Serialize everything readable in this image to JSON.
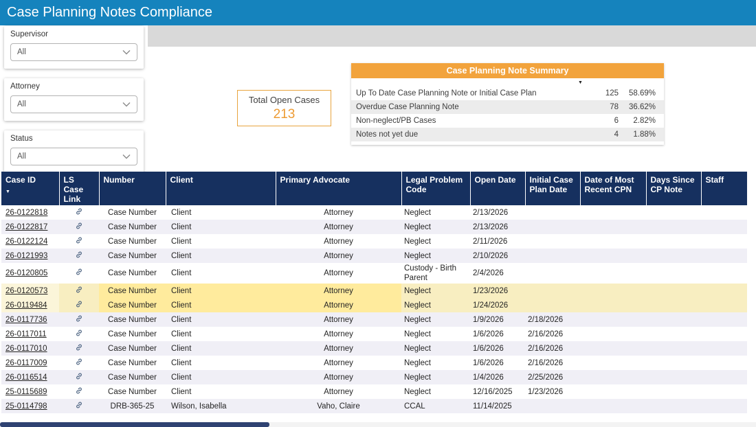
{
  "header": {
    "title": "Case Planning Notes Compliance"
  },
  "colors": {
    "title_bar_blue": "#1583bd",
    "accent_orange": "#f2a33c",
    "kpi_value_orange": "#ed9b33",
    "table_header_navy": "#16305f",
    "alt_row": "#f0eff6",
    "highlight_yellow": "#f8eec1",
    "highlight_strong_yellow": "#ffeb9d"
  },
  "filters": [
    {
      "label": "Supervisor",
      "value": "All",
      "icon": "chevron-down-icon"
    },
    {
      "label": "Attorney",
      "value": "All",
      "icon": "chevron-down-icon"
    },
    {
      "label": "Status",
      "value": "All",
      "icon": "chevron-down-icon"
    }
  ],
  "kpi": {
    "label": "Total Open Cases",
    "value": "213"
  },
  "summary": {
    "title": "Case Planning Note Summary",
    "caret_icon": "chevron-down-icon",
    "rows": [
      {
        "label": "Up To Date Case Planning Note or Initial Case Plan",
        "count": "125",
        "pct": "58.69%"
      },
      {
        "label": "Overdue Case Planning Note",
        "count": "78",
        "pct": "36.62%"
      },
      {
        "label": "Non-neglect/PB Cases",
        "count": "6",
        "pct": "2.82%"
      },
      {
        "label": "Notes not yet due",
        "count": "4",
        "pct": "1.88%"
      }
    ]
  },
  "table": {
    "columns": [
      "Case ID",
      "LS Case Link",
      "Number",
      "Client",
      "Primary Advocate",
      "Legal Problem Code",
      "Open Date",
      "Initial Case Plan Date",
      "Date of Most Recent CPN",
      "Days Since CP Note",
      "Staff"
    ],
    "sort_icon": "sort-descending-icon",
    "link_icon": "link-icon",
    "rows": [
      {
        "case_id": "26-0122818",
        "number": "Case Number",
        "client": "Client",
        "advocate": "Attorney",
        "code": "Neglect",
        "open_date": "2/13/2026",
        "plan_date": "",
        "cpn_date": "",
        "days": "",
        "staff": "",
        "highlight": false
      },
      {
        "case_id": "26-0122817",
        "number": "Case Number",
        "client": "Client",
        "advocate": "Attorney",
        "code": "Neglect",
        "open_date": "2/13/2026",
        "plan_date": "",
        "cpn_date": "",
        "days": "",
        "staff": "",
        "highlight": false
      },
      {
        "case_id": "26-0122124",
        "number": "Case Number",
        "client": "Client",
        "advocate": "Attorney",
        "code": "Neglect",
        "open_date": "2/11/2026",
        "plan_date": "",
        "cpn_date": "",
        "days": "",
        "staff": "",
        "highlight": false
      },
      {
        "case_id": "26-0121993",
        "number": "Case Number",
        "client": "Client",
        "advocate": "Attorney",
        "code": "Neglect",
        "open_date": "2/10/2026",
        "plan_date": "",
        "cpn_date": "",
        "days": "",
        "staff": "",
        "highlight": false
      },
      {
        "case_id": "26-0120805",
        "number": "Case Number",
        "client": "Client",
        "advocate": "Attorney",
        "code": "Custody - Birth Parent",
        "open_date": "2/4/2026",
        "plan_date": "",
        "cpn_date": "",
        "days": "",
        "staff": "",
        "highlight": false
      },
      {
        "case_id": "26-0120573",
        "number": "Case Number",
        "client": "Client",
        "advocate": "Attorney",
        "code": "Neglect",
        "open_date": "1/23/2026",
        "plan_date": "",
        "cpn_date": "",
        "days": "",
        "staff": "",
        "highlight": true
      },
      {
        "case_id": "26-0119484",
        "number": "Case Number",
        "client": "Client",
        "advocate": "Attorney",
        "code": "Neglect",
        "open_date": "1/24/2026",
        "plan_date": "",
        "cpn_date": "",
        "days": "",
        "staff": "",
        "highlight": true
      },
      {
        "case_id": "26-0117736",
        "number": "Case Number",
        "client": "Client",
        "advocate": "Attorney",
        "code": "Neglect",
        "open_date": "1/9/2026",
        "plan_date": "2/18/2026",
        "cpn_date": "",
        "days": "",
        "staff": "",
        "highlight": false
      },
      {
        "case_id": "26-0117011",
        "number": "Case Number",
        "client": "Client",
        "advocate": "Attorney",
        "code": "Neglect",
        "open_date": "1/6/2026",
        "plan_date": "2/16/2026",
        "cpn_date": "",
        "days": "",
        "staff": "",
        "highlight": false
      },
      {
        "case_id": "26-0117010",
        "number": "Case Number",
        "client": "Client",
        "advocate": "Attorney",
        "code": "Neglect",
        "open_date": "1/6/2026",
        "plan_date": "2/16/2026",
        "cpn_date": "",
        "days": "",
        "staff": "",
        "highlight": false
      },
      {
        "case_id": "26-0117009",
        "number": "Case Number",
        "client": "Client",
        "advocate": "Attorney",
        "code": "Neglect",
        "open_date": "1/6/2026",
        "plan_date": "2/16/2026",
        "cpn_date": "",
        "days": "",
        "staff": "",
        "highlight": false
      },
      {
        "case_id": "26-0116514",
        "number": "Case Number",
        "client": "Client",
        "advocate": "Attorney",
        "code": "Neglect",
        "open_date": "1/4/2026",
        "plan_date": "2/25/2026",
        "cpn_date": "",
        "days": "",
        "staff": "",
        "highlight": false
      },
      {
        "case_id": "25-0115689",
        "number": "Case Number",
        "client": "Client",
        "advocate": "Attorney",
        "code": "Neglect",
        "open_date": "12/16/2025",
        "plan_date": "1/23/2026",
        "cpn_date": "",
        "days": "",
        "staff": "",
        "highlight": false
      },
      {
        "case_id": "25-0114798",
        "number": "DRB-365-25",
        "client": "Wilson, Isabella",
        "advocate": "Vaho, Claire",
        "code": "CCAL",
        "open_date": "11/14/2025",
        "plan_date": "",
        "cpn_date": "",
        "days": "",
        "staff": "",
        "highlight": false
      }
    ]
  }
}
